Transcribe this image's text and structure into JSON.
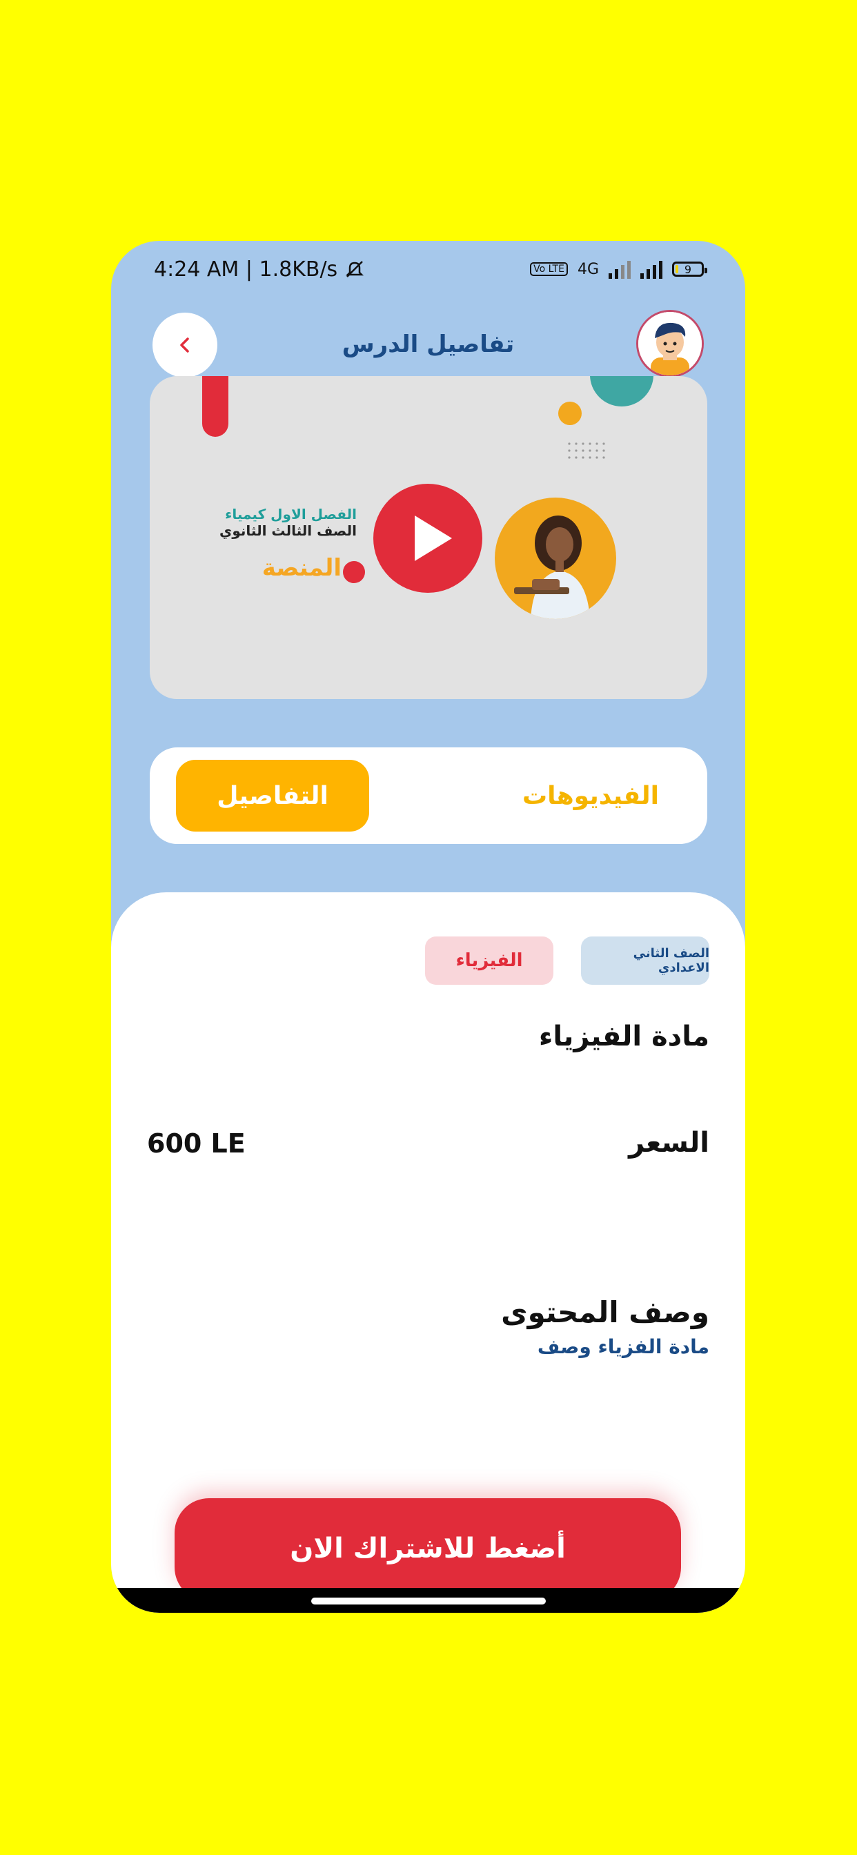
{
  "status_bar": {
    "time_speed": "4:24 AM | 1.8KB/s",
    "volte": "Vo LTE",
    "network": "4G",
    "battery": "9"
  },
  "header": {
    "title": "تفاصيل الدرس"
  },
  "video_card": {
    "line1": "الفصل الاول كيمياء",
    "line2": "الصف الثالث الثانوي",
    "brand": "المنصة"
  },
  "tabs": {
    "details": "التفاصيل",
    "videos": "الفيديوهات"
  },
  "details": {
    "grade_chip": "الصف الثاني الاعدادي",
    "subject_chip": "الفيزياء",
    "subject_title": "مادة الفيزياء",
    "price_label": "السعر",
    "price_value": "600 LE",
    "description_title": "وصف المحتوى",
    "description_text": "مادة الفزياء وصف"
  },
  "cta": {
    "subscribe": "أضغط للاشتراك الان"
  },
  "colors": {
    "page_bg": "#FFFF00",
    "phone_bg": "#A6C8EB",
    "accent_red": "#E12C3A",
    "accent_orange": "#FFB400",
    "title_blue": "#1a4b86"
  }
}
